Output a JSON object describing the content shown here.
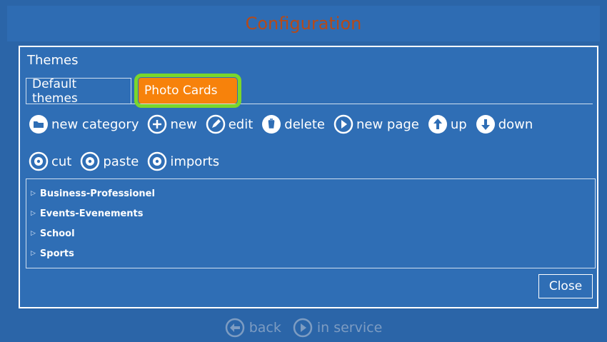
{
  "window": {
    "title": "Configuration"
  },
  "themes": {
    "label": "Themes",
    "tabs": [
      {
        "label": "Default themes"
      },
      {
        "label": "Photo Cards",
        "active": true
      }
    ]
  },
  "toolbar": {
    "row1": [
      {
        "label": "new category",
        "icon": "folder-icon"
      },
      {
        "label": "new",
        "icon": "plus-icon"
      },
      {
        "label": "edit",
        "icon": "pencil-icon"
      },
      {
        "label": "delete",
        "icon": "trash-icon"
      },
      {
        "label": "new page",
        "icon": "play-icon"
      },
      {
        "label": "up",
        "icon": "arrow-up-icon"
      },
      {
        "label": "down",
        "icon": "arrow-down-icon"
      }
    ],
    "row2": [
      {
        "label": "cut",
        "icon": "gear-icon"
      },
      {
        "label": "paste",
        "icon": "gear-icon"
      },
      {
        "label": "imports",
        "icon": "gear-icon"
      }
    ]
  },
  "tree": {
    "items": [
      {
        "label": "Business-Professionel"
      },
      {
        "label": "Events-Evenements"
      },
      {
        "label": "School"
      },
      {
        "label": "Sports"
      }
    ]
  },
  "close_label": "Close",
  "bottom": {
    "back_label": "back",
    "in_service_label": "in service"
  },
  "colors": {
    "background": "#2b65a8",
    "title_text": "#b64a18",
    "active_tab": "#f7820b",
    "highlight": "#7bd62b",
    "disabled_text": "#7d9cc2"
  }
}
